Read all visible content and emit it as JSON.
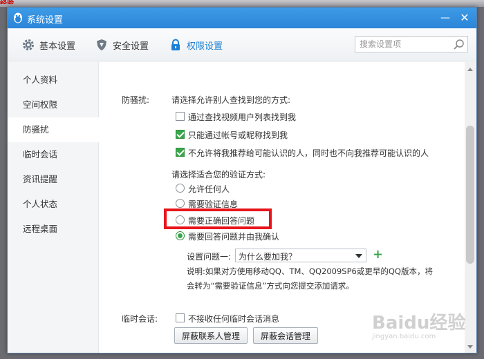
{
  "top_fragment": "经验",
  "window": {
    "title": "系统设置",
    "minimize_glyph": "—",
    "close_glyph": "✕"
  },
  "tabs": [
    {
      "label": "基本设置",
      "icon": "gear-icon"
    },
    {
      "label": "安全设置",
      "icon": "shield-icon"
    },
    {
      "label": "权限设置",
      "icon": "lock-icon",
      "active": true
    }
  ],
  "search": {
    "placeholder": "搜索设置项"
  },
  "sidebar": {
    "items": [
      {
        "label": "个人资料"
      },
      {
        "label": "空间权限"
      },
      {
        "label": "防骚扰",
        "active": true
      },
      {
        "label": "临时会话"
      },
      {
        "label": "资讯提醒"
      },
      {
        "label": "个人状态"
      },
      {
        "label": "远程桌面"
      }
    ]
  },
  "anti_harass": {
    "section_label": "防骚扰:",
    "find_prompt": "请选择允许别人查找到您的方式:",
    "find_options": [
      {
        "label": "通过查找视频用户列表找到我",
        "checked": false
      },
      {
        "label": "只能通过帐号或昵称找到我",
        "checked": true
      },
      {
        "label": "不允许将我推荐给可能认识的人，同时也不向我推荐可能认识的人",
        "checked": true
      }
    ],
    "verify_prompt": "请选择适合您的验证方式:",
    "verify_options": [
      {
        "label": "允许任何人",
        "checked": false
      },
      {
        "label": "需要验证信息",
        "checked": false
      },
      {
        "label": "需要正确回答问题",
        "checked": false,
        "highlighted": true
      },
      {
        "label": "需要回答问题并由我确认",
        "checked": true
      }
    ],
    "question_label": "设置问题一:",
    "question_value": "为什么要加我？",
    "add_glyph": "+",
    "note_line1": "说明:如果对方使用移动QQ、TM、QQ2009SP6或更早的QQ版本，将",
    "note_line2": "会转为“需要验证信息”方式向您提交添加请求。"
  },
  "temp_session": {
    "section_label": "临时会话:",
    "option": {
      "label": "不接收任何临时会话消息",
      "checked": false
    },
    "buttons": [
      "屏蔽联系人管理",
      "屏蔽会话管理"
    ]
  },
  "watermark": {
    "line1": "Baidu经验",
    "line2": "jingyan.baidu.com"
  },
  "colors": {
    "titlebar": "#2b85d9",
    "accent": "#1c7fd4",
    "check_green": "#3aa64b",
    "highlight_red": "#e8141b"
  }
}
